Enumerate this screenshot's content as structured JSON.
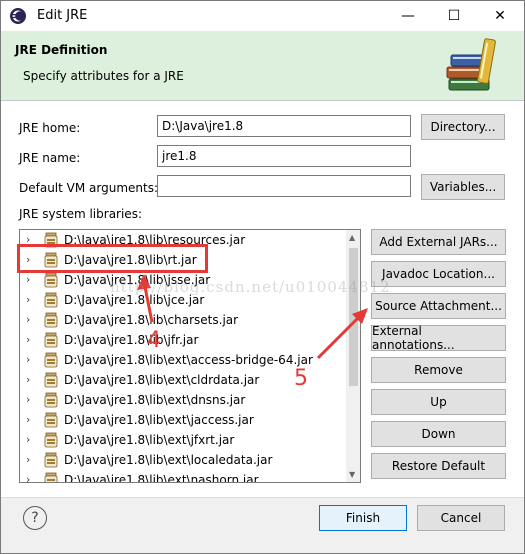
{
  "window": {
    "title": "Edit JRE",
    "minimize_glyph": "—",
    "maximize_glyph": "☐",
    "close_glyph": "✕"
  },
  "banner": {
    "heading": "JRE Definition",
    "subtitle": "Specify attributes for a JRE"
  },
  "form": {
    "jre_home_label": "JRE home:",
    "jre_home_value": "D:\\Java\\jre1.8",
    "directory_button": "Directory...",
    "jre_name_label": "JRE name:",
    "jre_name_value": "jre1.8",
    "vm_args_label": "Default VM arguments:",
    "vm_args_value": "",
    "variables_button": "Variables...",
    "libraries_label": "JRE system libraries:"
  },
  "libraries": [
    "D:\\Java\\jre1.8\\lib\\resources.jar",
    "D:\\Java\\jre1.8\\lib\\rt.jar",
    "D:\\Java\\jre1.8\\lib\\jsse.jar",
    "D:\\Java\\jre1.8\\lib\\jce.jar",
    "D:\\Java\\jre1.8\\lib\\charsets.jar",
    "D:\\Java\\jre1.8\\lib\\jfr.jar",
    "D:\\Java\\jre1.8\\lib\\ext\\access-bridge-64.jar",
    "D:\\Java\\jre1.8\\lib\\ext\\cldrdata.jar",
    "D:\\Java\\jre1.8\\lib\\ext\\dnsns.jar",
    "D:\\Java\\jre1.8\\lib\\ext\\jaccess.jar",
    "D:\\Java\\jre1.8\\lib\\ext\\jfxrt.jar",
    "D:\\Java\\jre1.8\\lib\\ext\\localedata.jar",
    "D:\\Java\\jre1.8\\lib\\ext\\nashorn.jar"
  ],
  "side_buttons": {
    "add_external_jars": "Add External JARs...",
    "javadoc_location": "Javadoc Location...",
    "source_attachment": "Source Attachment...",
    "external_annotations": "External annotations...",
    "remove": "Remove",
    "up": "Up",
    "down": "Down",
    "restore_default": "Restore Default"
  },
  "footer": {
    "help_glyph": "?",
    "finish": "Finish",
    "cancel": "Cancel"
  },
  "annotations": {
    "label_4": "4",
    "label_5": "5",
    "watermark": "http://blog.csdn.net/u010044812"
  },
  "colors": {
    "banner_bg": "#ddf0dd",
    "annotation_red": "#e53935",
    "focus_blue": "#0078d7"
  }
}
